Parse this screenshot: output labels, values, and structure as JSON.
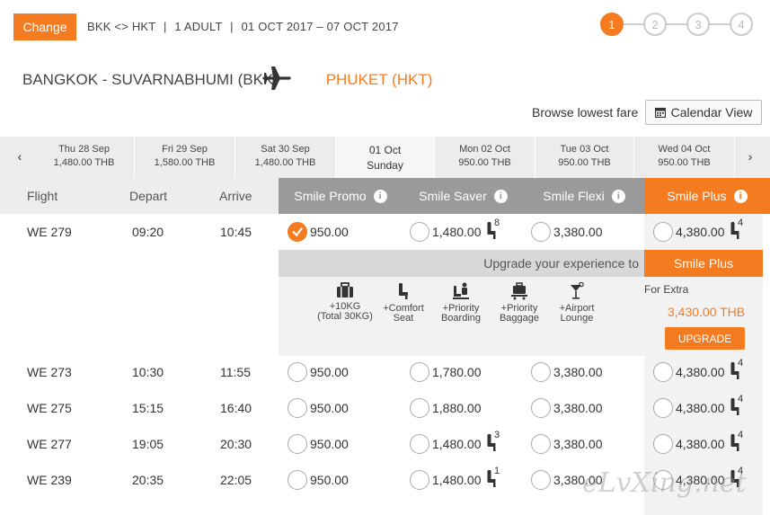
{
  "search": {
    "change_label": "Change",
    "route": "BKK <> HKT",
    "passengers": "1 ADULT",
    "dates": "01 OCT 2017 – 07 OCT 2017",
    "separator": "|"
  },
  "steps": [
    "1",
    "2",
    "3",
    "4"
  ],
  "route_title": {
    "origin": "BANGKOK - SUVARNABHUMI (BKK)",
    "destination": "PHUKET (HKT)"
  },
  "browse": {
    "label": "Browse lowest fare",
    "calendar_label": "Calendar View"
  },
  "dates": [
    {
      "day": "Thu 28 Sep",
      "price": "1,480.00 THB"
    },
    {
      "day": "Fri 29 Sep",
      "price": "1,580.00 THB"
    },
    {
      "day": "Sat 30 Sep",
      "price": "1,480.00 THB"
    },
    {
      "day": "01 Oct",
      "price": "Sunday"
    },
    {
      "day": "Mon 02 Oct",
      "price": "950.00 THB"
    },
    {
      "day": "Tue 03 Oct",
      "price": "950.00 THB"
    },
    {
      "day": "Wed 04 Oct",
      "price": "950.00 THB"
    }
  ],
  "nav": {
    "prev": "‹",
    "next": "›"
  },
  "headers": {
    "flight": "Flight",
    "depart": "Depart",
    "arrive": "Arrive",
    "fares": [
      "Smile Promo",
      "Smile Saver",
      "Smile Flexi",
      "Smile Plus"
    ]
  },
  "flights": [
    {
      "flight": "WE 279",
      "depart": "09:20",
      "arrive": "10:45",
      "promo": "950.00",
      "saver": "1,480.00",
      "saver_seats": "8",
      "flexi": "3,380.00",
      "plus": "4,380.00",
      "plus_seats": "4"
    },
    {
      "flight": "WE 273",
      "depart": "10:30",
      "arrive": "11:55",
      "promo": "950.00",
      "saver": "1,780.00",
      "saver_seats": "",
      "flexi": "3,380.00",
      "plus": "4,380.00",
      "plus_seats": "4"
    },
    {
      "flight": "WE 275",
      "depart": "15:15",
      "arrive": "16:40",
      "promo": "950.00",
      "saver": "1,880.00",
      "saver_seats": "",
      "flexi": "3,380.00",
      "plus": "4,380.00",
      "plus_seats": "4"
    },
    {
      "flight": "WE 277",
      "depart": "19:05",
      "arrive": "20:30",
      "promo": "950.00",
      "saver": "1,480.00",
      "saver_seats": "3",
      "flexi": "3,380.00",
      "plus": "4,380.00",
      "plus_seats": "4"
    },
    {
      "flight": "WE 239",
      "depart": "20:35",
      "arrive": "22:05",
      "promo": "950.00",
      "saver": "1,480.00",
      "saver_seats": "1",
      "flexi": "3,380.00",
      "plus": "4,380.00",
      "plus_seats": "4"
    }
  ],
  "upgrade": {
    "prompt": "Upgrade your experience to",
    "target": "Smile Plus",
    "features": [
      {
        "icon": "baggage-icon",
        "line1": "+10KG",
        "line2": "(Total 30KG)"
      },
      {
        "icon": "comfort-seat-icon",
        "line1": "+Comfort",
        "line2": "Seat"
      },
      {
        "icon": "priority-boarding-icon",
        "line1": "+Priority",
        "line2": "Boarding"
      },
      {
        "icon": "priority-baggage-icon",
        "line1": "+Priority",
        "line2": "Baggage"
      },
      {
        "icon": "airport-lounge-icon",
        "line1": "+Airport",
        "line2": "Lounge"
      }
    ],
    "extra_label": "For Extra",
    "extra_value": "3,430.00 THB",
    "button_label": "UPGRADE"
  },
  "watermark": "eLvXing.net",
  "colors": {
    "accent": "#f47b20",
    "header_gray": "#9a9a9a"
  },
  "icons": {
    "plane": "plane-icon",
    "calendar": "calendar-icon",
    "info": "info-icon",
    "seat": "seat-icon",
    "check": "check-icon"
  }
}
